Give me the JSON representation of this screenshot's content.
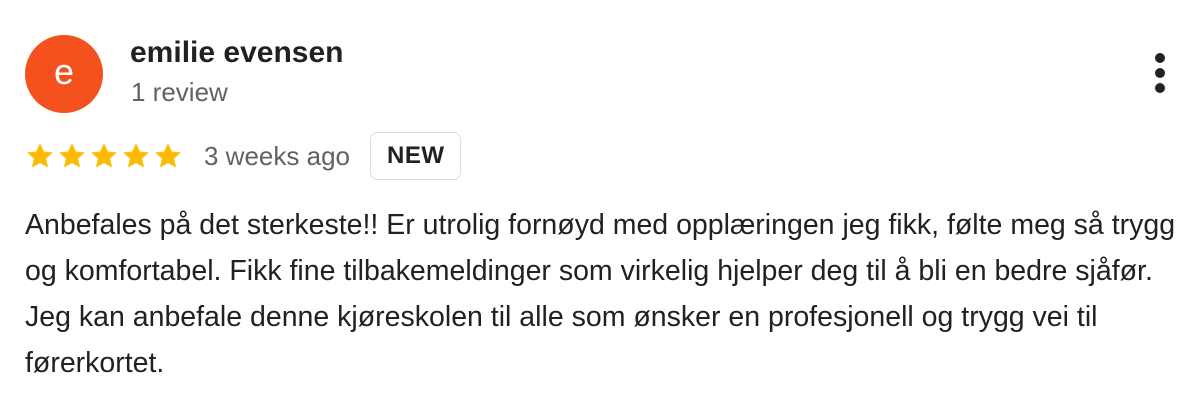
{
  "review": {
    "reviewer": {
      "avatar_letter": "e",
      "avatar_color": "#f4511e",
      "name": "emilie evensen",
      "review_count": "1 review"
    },
    "rating": {
      "stars": 5,
      "max_stars": 5,
      "star_color": "#fbbc04"
    },
    "date": "3 weeks ago",
    "badge": "NEW",
    "more_icon": "more-vert-icon",
    "text": "Anbefales på det sterkeste!! Er utrolig fornøyd med opplæringen jeg fikk, følte meg så trygg og komfortabel. Fikk fine tilbakemeldinger som virkelig hjelper deg til å bli en bedre sjåfør. Jeg kan anbefale denne kjøreskolen til alle som ønsker en profesjonell og trygg vei til førerkortet."
  }
}
